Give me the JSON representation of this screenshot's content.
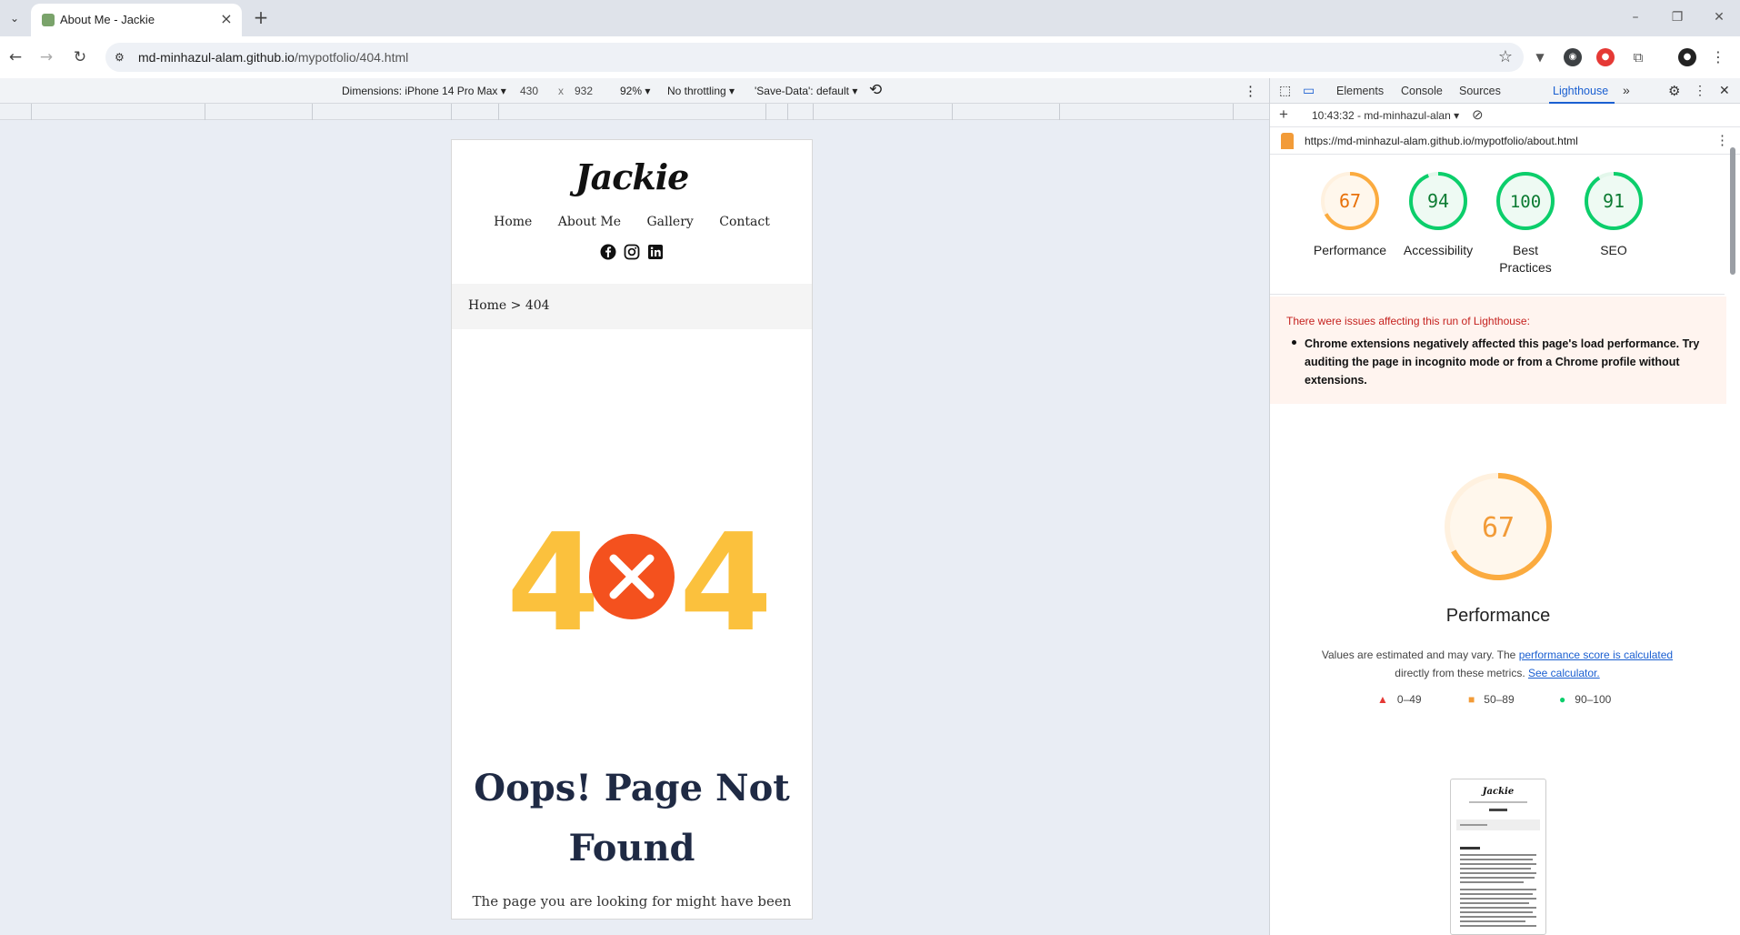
{
  "browser": {
    "tab_title": "About Me - Jackie",
    "url_host": "md-minhazul-alam.github.io",
    "url_path": "/mypotfolio/404.html"
  },
  "device_toolbar": {
    "dimensions_label": "Dimensions: iPhone 14 Pro Max",
    "width": "430",
    "times": "x",
    "height": "932",
    "zoom": "92%",
    "throttling": "No throttling",
    "save_data": "'Save-Data': default"
  },
  "page": {
    "logo": "Jackie",
    "nav": [
      "Home",
      "About Me",
      "Gallery",
      "Contact"
    ],
    "breadcrumb": "Home > 404",
    "error_code": "4",
    "heading": "Oops! Page Not Found",
    "description": "The page you are looking for might have been"
  },
  "devtools": {
    "tabs": [
      "Elements",
      "Console",
      "Sources",
      "Lighthouse"
    ],
    "report_time": "10:43:32 - md-minhazul-alan",
    "report_url": "https://md-minhazul-alam.github.io/mypotfolio/about.html",
    "scores": [
      {
        "value": "67",
        "label": "Performance",
        "color": "#e8710a",
        "ring": "#fbab3f",
        "fraction": 0.67
      },
      {
        "value": "94",
        "label": "Accessibility",
        "color": "#0c7b32",
        "ring": "#0cce6b",
        "fraction": 0.94
      },
      {
        "value": "100",
        "label": "Best Practices",
        "color": "#0c7b32",
        "ring": "#0cce6b",
        "fraction": 1.0
      },
      {
        "value": "91",
        "label": "SEO",
        "color": "#0c7b32",
        "ring": "#0cce6b",
        "fraction": 0.91
      }
    ],
    "warning_title": "There were issues affecting this run of Lighthouse:",
    "warning_item": "Chrome extensions negatively affected this page's load performance. Try auditing the page in incognito mode or from a Chrome profile without extensions.",
    "perf_score": "67",
    "perf_title": "Performance",
    "perf_note_1": "Values are estimated and may vary. The",
    "perf_link_1": "performance score is calculated",
    "perf_note_2": "directly from these metrics.",
    "perf_link_2": "See calculator.",
    "legend": [
      "0–49",
      "50–89",
      "90–100"
    ]
  }
}
